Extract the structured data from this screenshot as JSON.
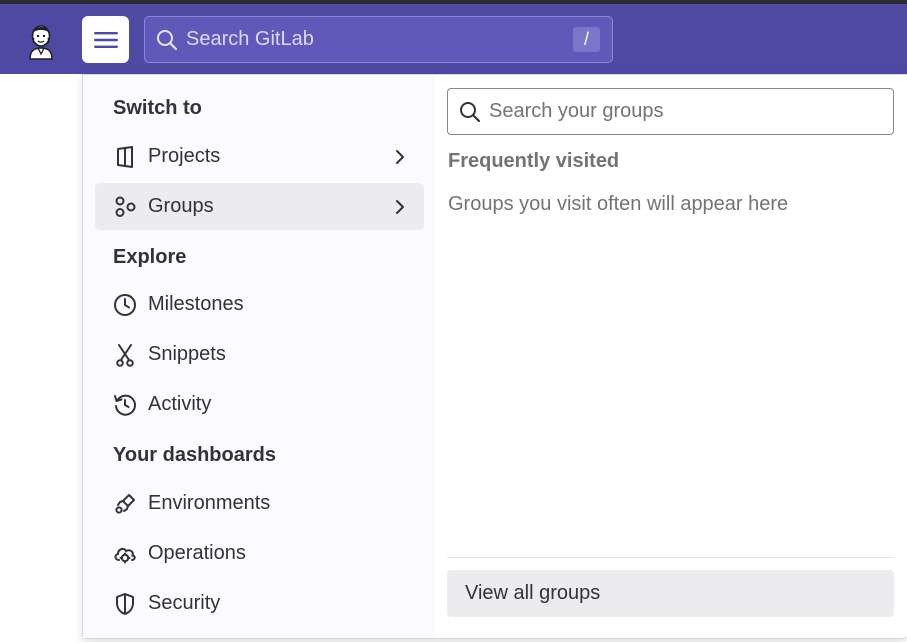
{
  "navbar": {
    "search_placeholder": "Search GitLab",
    "search_shortcut": "/",
    "brand_color": "#4e49a3"
  },
  "menu": {
    "sections": {
      "switch_to": "Switch to",
      "explore": "Explore",
      "dashboards": "Your dashboards"
    },
    "items": [
      {
        "label": "Projects",
        "icon": "project-icon",
        "has_submenu": true
      },
      {
        "label": "Groups",
        "icon": "group-icon",
        "has_submenu": true,
        "active": true
      },
      {
        "label": "Milestones",
        "icon": "clock-icon"
      },
      {
        "label": "Snippets",
        "icon": "snippet-icon"
      },
      {
        "label": "Activity",
        "icon": "history-icon"
      },
      {
        "label": "Environments",
        "icon": "rocket-icon"
      },
      {
        "label": "Operations",
        "icon": "cloud-gear-icon"
      },
      {
        "label": "Security",
        "icon": "shield-icon"
      }
    ]
  },
  "groups_panel": {
    "search_placeholder": "Search your groups",
    "frequently_visited_title": "Frequently visited",
    "empty_message": "Groups you visit often will appear here",
    "view_all_label": "View all groups"
  }
}
